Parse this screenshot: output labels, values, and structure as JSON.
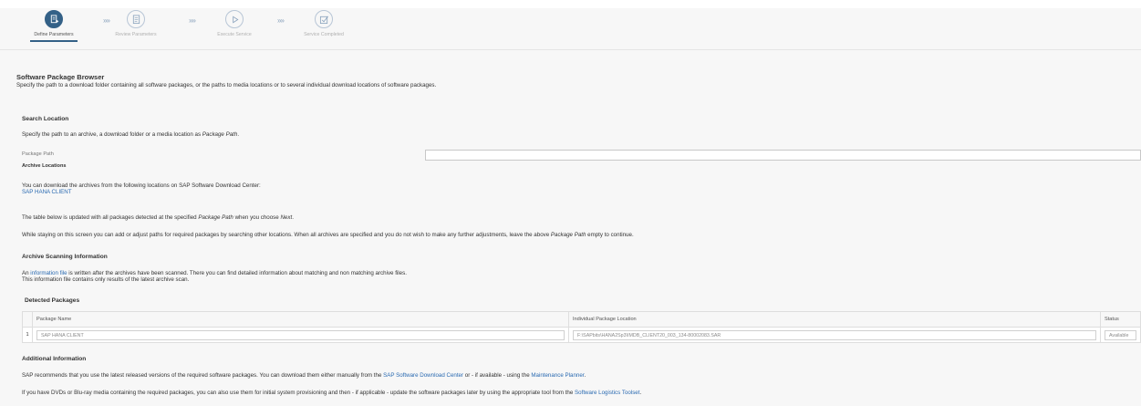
{
  "wizard": {
    "steps": [
      {
        "label": "Define Parameters",
        "icon": "document-edit-icon"
      },
      {
        "label": "Review Parameters",
        "icon": "review-document-icon"
      },
      {
        "label": "Execute Service",
        "icon": "play-icon"
      },
      {
        "label": "Service Completed",
        "icon": "checkbox-done-icon"
      }
    ],
    "separator": "»»"
  },
  "browser": {
    "title": "Software Package Browser",
    "description": "Specify the path to a download folder containing all software packages, or the paths to media locations or to several individual download locations of software packages."
  },
  "search": {
    "heading": "Search Location",
    "intro_prefix": "Specify the path to an archive, a download folder or a media location as ",
    "intro_em": "Package Path",
    "intro_suffix": ".",
    "package_path_label": "Package Path",
    "package_path_value": ""
  },
  "archive_locations": {
    "heading": "Archive Locations",
    "text": "You can download the archives from the following locations on SAP Software Download Center:",
    "link": "SAP HANA CLIENT"
  },
  "table_note": {
    "prefix": "The table below is updated with all packages detected at the specified ",
    "em1": "Package Path",
    "middle": " when you choose ",
    "em2": "Next",
    "suffix": "."
  },
  "staying_note": {
    "prefix": "While staying on this screen you can add or adjust paths for required packages by searching other locations. When all archives are specified and you do not wish to make any further adjustments, leave the above ",
    "em": "Package Path",
    "suffix": " empty to continue."
  },
  "scanning": {
    "heading": "Archive Scanning Information",
    "line1_prefix": "An ",
    "line1_link": "information file",
    "line1_suffix": " is written after the archives have been scanned. There you can find detailed information about matching and non matching archive files.",
    "line2": "This information file contains only results of the latest archive scan."
  },
  "detected": {
    "heading": "Detected Packages",
    "columns": [
      "Package Name",
      "Individual Package Location",
      "Status"
    ],
    "rows": [
      {
        "num": "1",
        "name": "SAP HANA CLIENT",
        "location": "F:\\SAPbits\\HANA2Sp3\\IMDB_CLIENT20_003_134-80002083.SAR",
        "status": "Available"
      }
    ]
  },
  "additional": {
    "heading": "Additional Information",
    "p1_prefix": "SAP recommends that you use the latest released versions of the required software packages. You can download them either manually from the ",
    "p1_link1": "SAP Software Download Center",
    "p1_middle": " or - if available - using the ",
    "p1_link2": "Maintenance Planner",
    "p1_suffix": ".",
    "p2_prefix": "If you have DVDs or Blu-ray media containing the required packages, you can also use them for initial system provisioning and then - if applicable - update the software packages later by using the appropriate tool from the ",
    "p2_link": "Software Logistics Toolset",
    "p2_suffix": "."
  },
  "colors": {
    "accent": "#346187",
    "link": "#2a6ab1",
    "background": "#f7f7f7"
  }
}
